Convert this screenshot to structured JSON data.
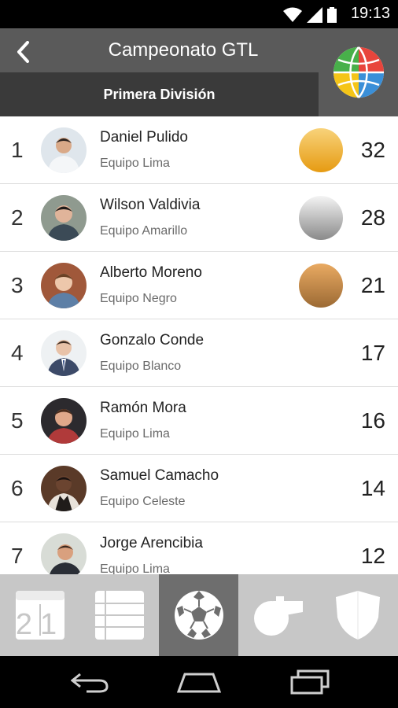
{
  "status_bar": {
    "time": "19:13"
  },
  "app_bar": {
    "title": "Campeonato GTL",
    "tab_label": "Primera División"
  },
  "standings": [
    {
      "rank": "1",
      "name": "Daniel Pulido",
      "team": "Equipo Lima",
      "points": "32",
      "medal": "gold"
    },
    {
      "rank": "2",
      "name": "Wilson Valdivia",
      "team": "Equipo Amarillo",
      "points": "28",
      "medal": "silver"
    },
    {
      "rank": "3",
      "name": "Alberto Moreno",
      "team": "Equipo Negro",
      "points": "21",
      "medal": "bronze"
    },
    {
      "rank": "4",
      "name": "Gonzalo Conde",
      "team": "Equipo Blanco",
      "points": "17",
      "medal": ""
    },
    {
      "rank": "5",
      "name": "Ramón Mora",
      "team": "Equipo Lima",
      "points": "16",
      "medal": ""
    },
    {
      "rank": "6",
      "name": "Samuel Camacho",
      "team": "Equipo Celeste",
      "points": "14",
      "medal": ""
    },
    {
      "rank": "7",
      "name": "Jorge Arencibia",
      "team": "Equipo Lima",
      "points": "12",
      "medal": ""
    }
  ],
  "bottom_nav": {
    "items": [
      {
        "icon": "calendar-icon",
        "active": false
      },
      {
        "icon": "table-icon",
        "active": false
      },
      {
        "icon": "soccer-ball-icon",
        "active": true
      },
      {
        "icon": "whistle-icon",
        "active": false
      },
      {
        "icon": "shield-icon",
        "active": false
      }
    ],
    "calendar_digits": "21"
  },
  "colors": {
    "app_bar": "#5a5a5a",
    "tab_strip": "#3a3a3a",
    "bottom_nav": "#c7c7c7",
    "bottom_nav_active": "#6e6e6e",
    "gold": "#e69b12",
    "silver": "#8a8a8a",
    "bronze": "#9c6a34"
  }
}
